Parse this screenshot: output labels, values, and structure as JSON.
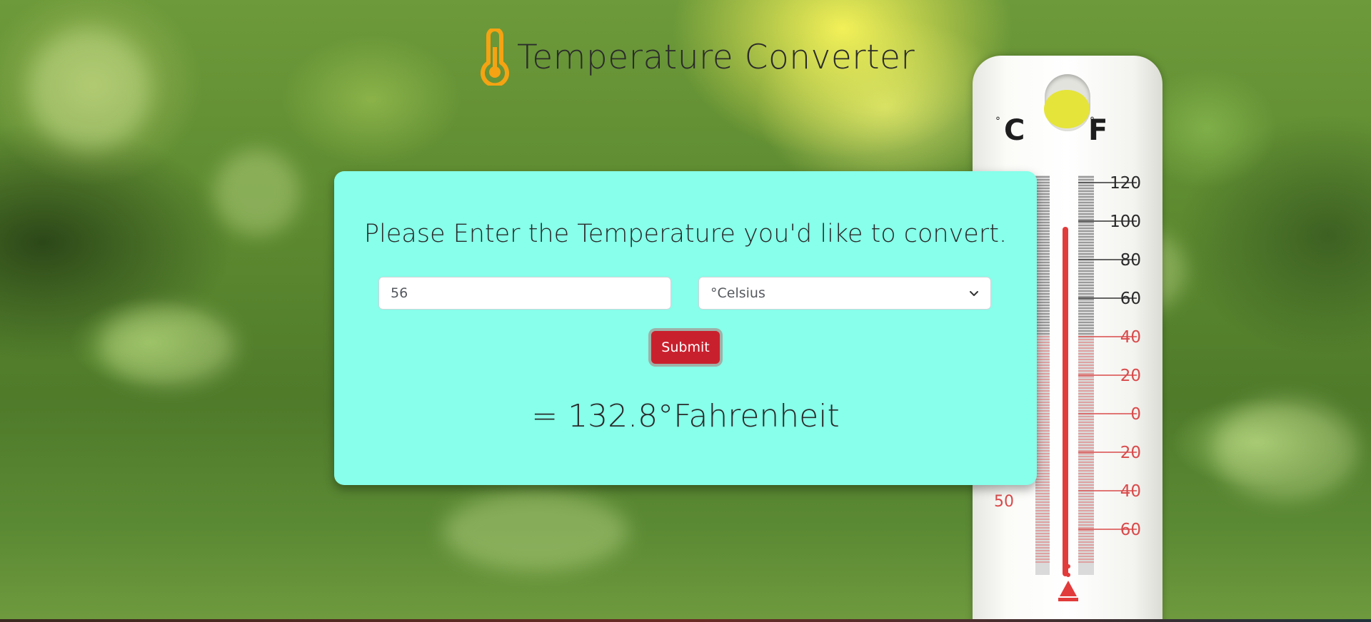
{
  "header": {
    "title": "Temperature Converter",
    "icon": "thermometer-icon",
    "icon_color": "#f5a312"
  },
  "converter": {
    "prompt": "Please Enter the Temperature you'd like to convert.",
    "input_value": "56",
    "unit_selected": "°Celsius",
    "submit_label": "Submit",
    "result": "= 132.8°Fahrenheit"
  },
  "thermometer": {
    "c_label": "C",
    "f_label": "F",
    "f_ticks": [
      "120",
      "100",
      "80",
      "60",
      "40",
      "20",
      "0",
      "20",
      "40",
      "60"
    ],
    "c_tick": "50"
  },
  "colors": {
    "card_background": "#87ffea",
    "submit_background": "#c9202d",
    "text": "#2a2a2a"
  }
}
